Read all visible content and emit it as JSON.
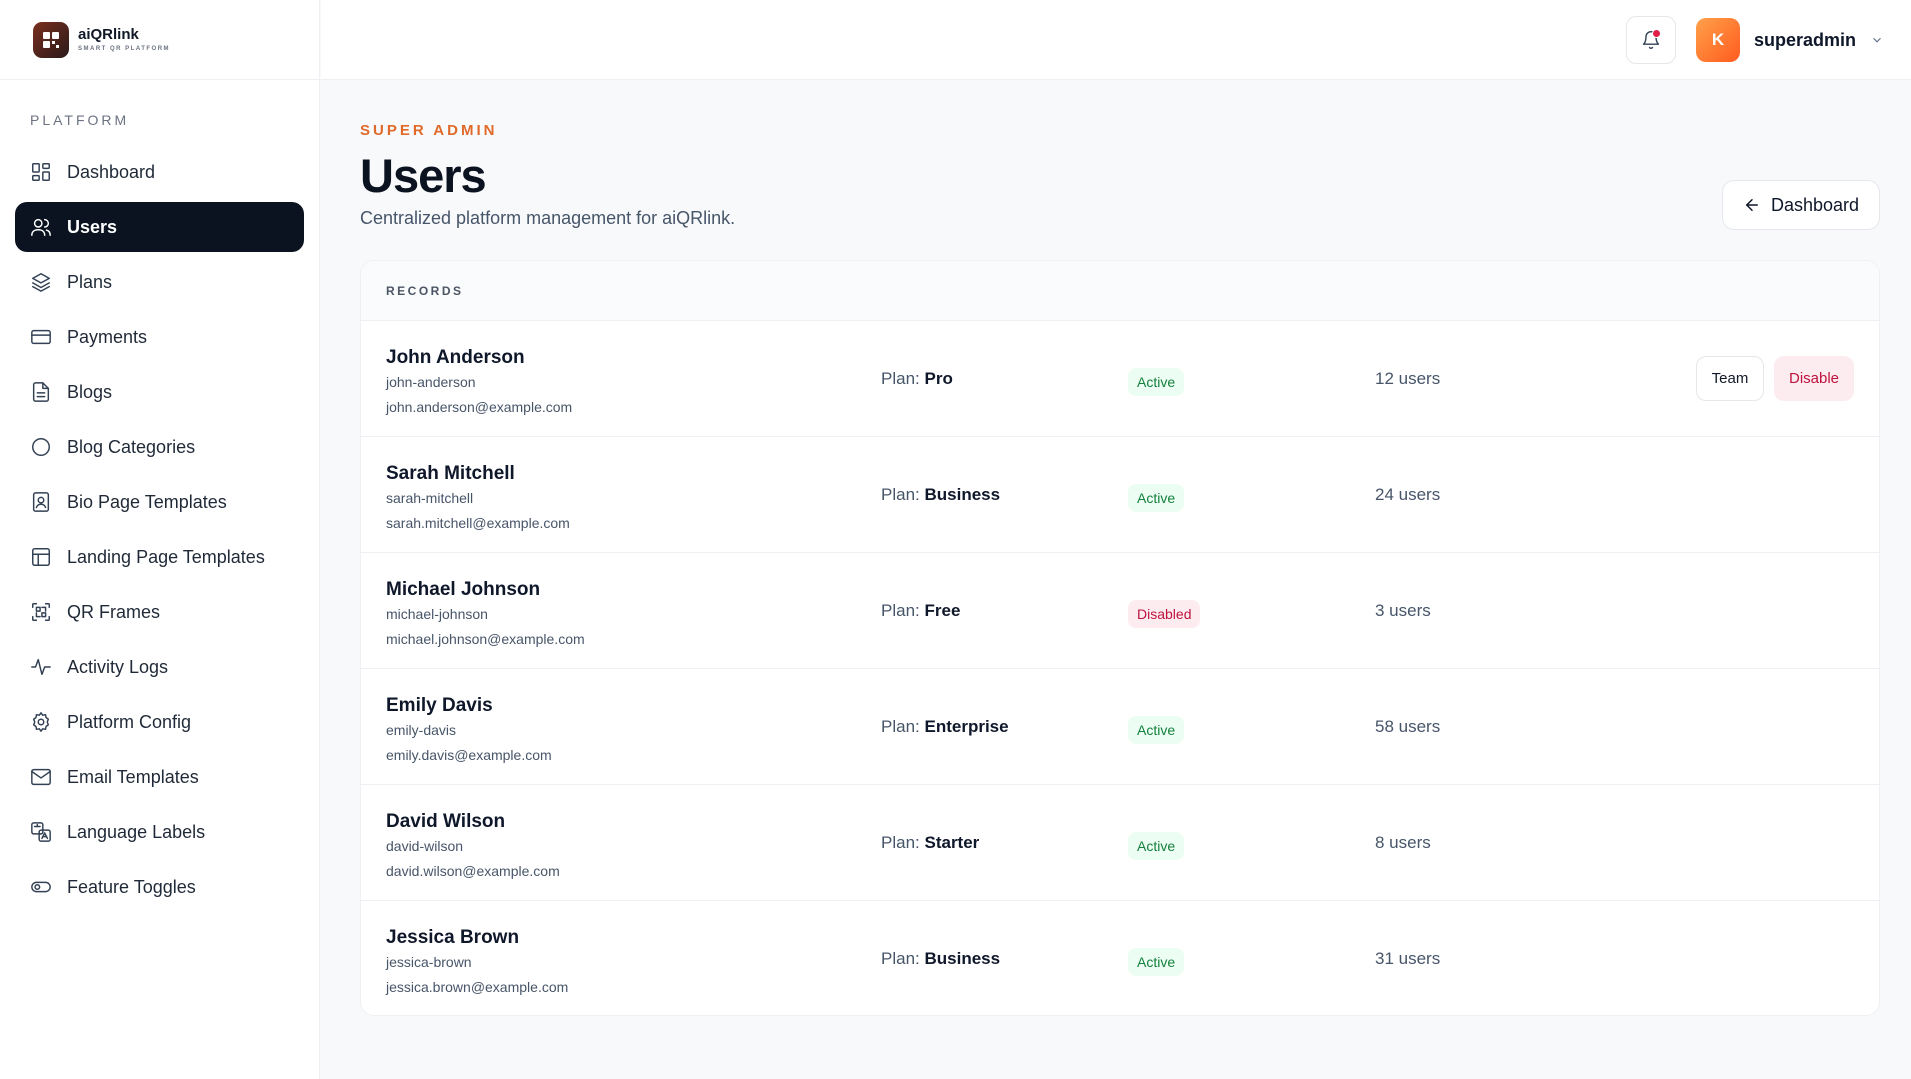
{
  "brand": {
    "name": "aiQRlink",
    "tagline": "SMART QR PLATFORM"
  },
  "sidebar": {
    "section_label": "PLATFORM",
    "items": [
      {
        "label": "Dashboard",
        "icon": "grid-icon"
      },
      {
        "label": "Users",
        "icon": "users-icon",
        "active": true
      },
      {
        "label": "Plans",
        "icon": "layers-icon"
      },
      {
        "label": "Payments",
        "icon": "credit-card-icon"
      },
      {
        "label": "Blogs",
        "icon": "document-icon"
      },
      {
        "label": "Blog Categories",
        "icon": "circle-icon"
      },
      {
        "label": "Bio Page Templates",
        "icon": "id-badge-icon"
      },
      {
        "label": "Landing Page Templates",
        "icon": "layout-icon"
      },
      {
        "label": "QR Frames",
        "icon": "qr-scan-icon"
      },
      {
        "label": "Activity Logs",
        "icon": "activity-icon"
      },
      {
        "label": "Platform Config",
        "icon": "gear-icon"
      },
      {
        "label": "Email Templates",
        "icon": "mail-icon"
      },
      {
        "label": "Language Labels",
        "icon": "translate-icon"
      },
      {
        "label": "Feature Toggles",
        "icon": "toggle-icon"
      }
    ]
  },
  "header": {
    "user_initial": "K",
    "user_name": "superadmin"
  },
  "page": {
    "eyebrow": "SUPER ADMIN",
    "title": "Users",
    "subtitle": "Centralized platform management for aiQRlink.",
    "back_label": "Dashboard"
  },
  "records": {
    "heading": "RECORDS",
    "plan_prefix": "Plan:",
    "rows": [
      {
        "name": "John Anderson",
        "slug": "john-anderson",
        "email": "john.anderson@example.com",
        "plan": "Pro",
        "status": "Active",
        "count": "12 users",
        "team_label": "Team",
        "disable_label": "Disable"
      },
      {
        "name": "Sarah Mitchell",
        "slug": "sarah-mitchell",
        "email": "sarah.mitchell@example.com",
        "plan": "Business",
        "status": "Active",
        "count": "24 users"
      },
      {
        "name": "Michael Johnson",
        "slug": "michael-johnson",
        "email": "michael.johnson@example.com",
        "plan": "Free",
        "status": "Disabled",
        "count": "3 users"
      },
      {
        "name": "Emily Davis",
        "slug": "emily-davis",
        "email": "emily.davis@example.com",
        "plan": "Enterprise",
        "status": "Active",
        "count": "58 users"
      },
      {
        "name": "David Wilson",
        "slug": "david-wilson",
        "email": "david.wilson@example.com",
        "plan": "Starter",
        "status": "Active",
        "count": "8 users"
      },
      {
        "name": "Jessica Brown",
        "slug": "jessica-brown",
        "email": "jessica.brown@example.com",
        "plan": "Business",
        "status": "Active",
        "count": "31 users"
      }
    ]
  },
  "colors": {
    "accent": "#e06a2a",
    "active_nav": "#0b1220",
    "status_active": "#15803d",
    "status_disabled": "#be123c"
  }
}
